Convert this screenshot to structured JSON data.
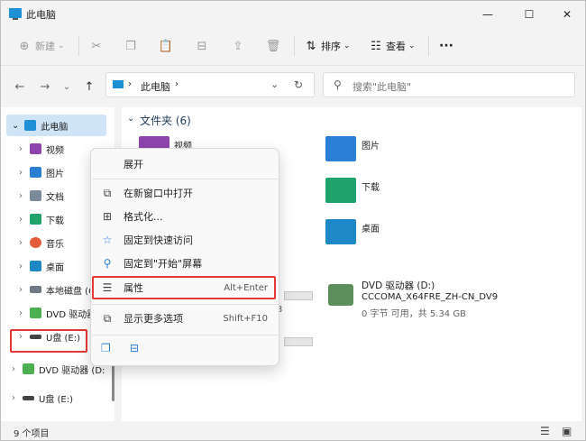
{
  "window": {
    "title": "此电脑",
    "min_glyph": "—",
    "max_glyph": "☐",
    "close_glyph": "✕"
  },
  "toolbar": {
    "new_label": "新建",
    "sort_label": "排序",
    "view_label": "查看",
    "more_label": "···"
  },
  "address": {
    "path": "此电脑",
    "search_placeholder": "搜索\"此电脑\""
  },
  "sidebar": {
    "items": [
      {
        "label": "此电脑"
      },
      {
        "label": "视频"
      },
      {
        "label": "图片"
      },
      {
        "label": "文档"
      },
      {
        "label": "下载"
      },
      {
        "label": "音乐"
      },
      {
        "label": "桌面"
      },
      {
        "label": "本地磁盘 (C"
      },
      {
        "label": "DVD 驱动器"
      },
      {
        "label": "U盘 (E:)"
      },
      {
        "label": "DVD 驱动器 (D:"
      },
      {
        "label": "U盘 (E:)"
      }
    ]
  },
  "content": {
    "folders_header": "文件夹 (6)",
    "folders": [
      {
        "label": "视频"
      },
      {
        "label": "图片"
      },
      {
        "label": "下载"
      },
      {
        "label": "桌面"
      }
    ],
    "drive": {
      "name": "DVD 驱动器 (D:)",
      "volume": "CCCOMA_X64FRE_ZH-CN_DV9",
      "usage": "0 字节 可用，共 5.34 GB"
    },
    "partial_c": "3"
  },
  "context_menu": {
    "items": [
      {
        "label": "展开",
        "shortcut": ""
      },
      {
        "label": "在新窗口中打开",
        "shortcut": ""
      },
      {
        "label": "格式化...",
        "shortcut": ""
      },
      {
        "label": "固定到快速访问",
        "shortcut": ""
      },
      {
        "label": "固定到\"开始\"屏幕",
        "shortcut": ""
      },
      {
        "label": "属性",
        "shortcut": "Alt+Enter"
      },
      {
        "label": "显示更多选项",
        "shortcut": "Shift+F10"
      }
    ]
  },
  "status": {
    "count": "9 个项目"
  },
  "colors": {
    "accent": "#1e90d6",
    "highlight": "#e53935",
    "selection": "#cfe4f7"
  }
}
